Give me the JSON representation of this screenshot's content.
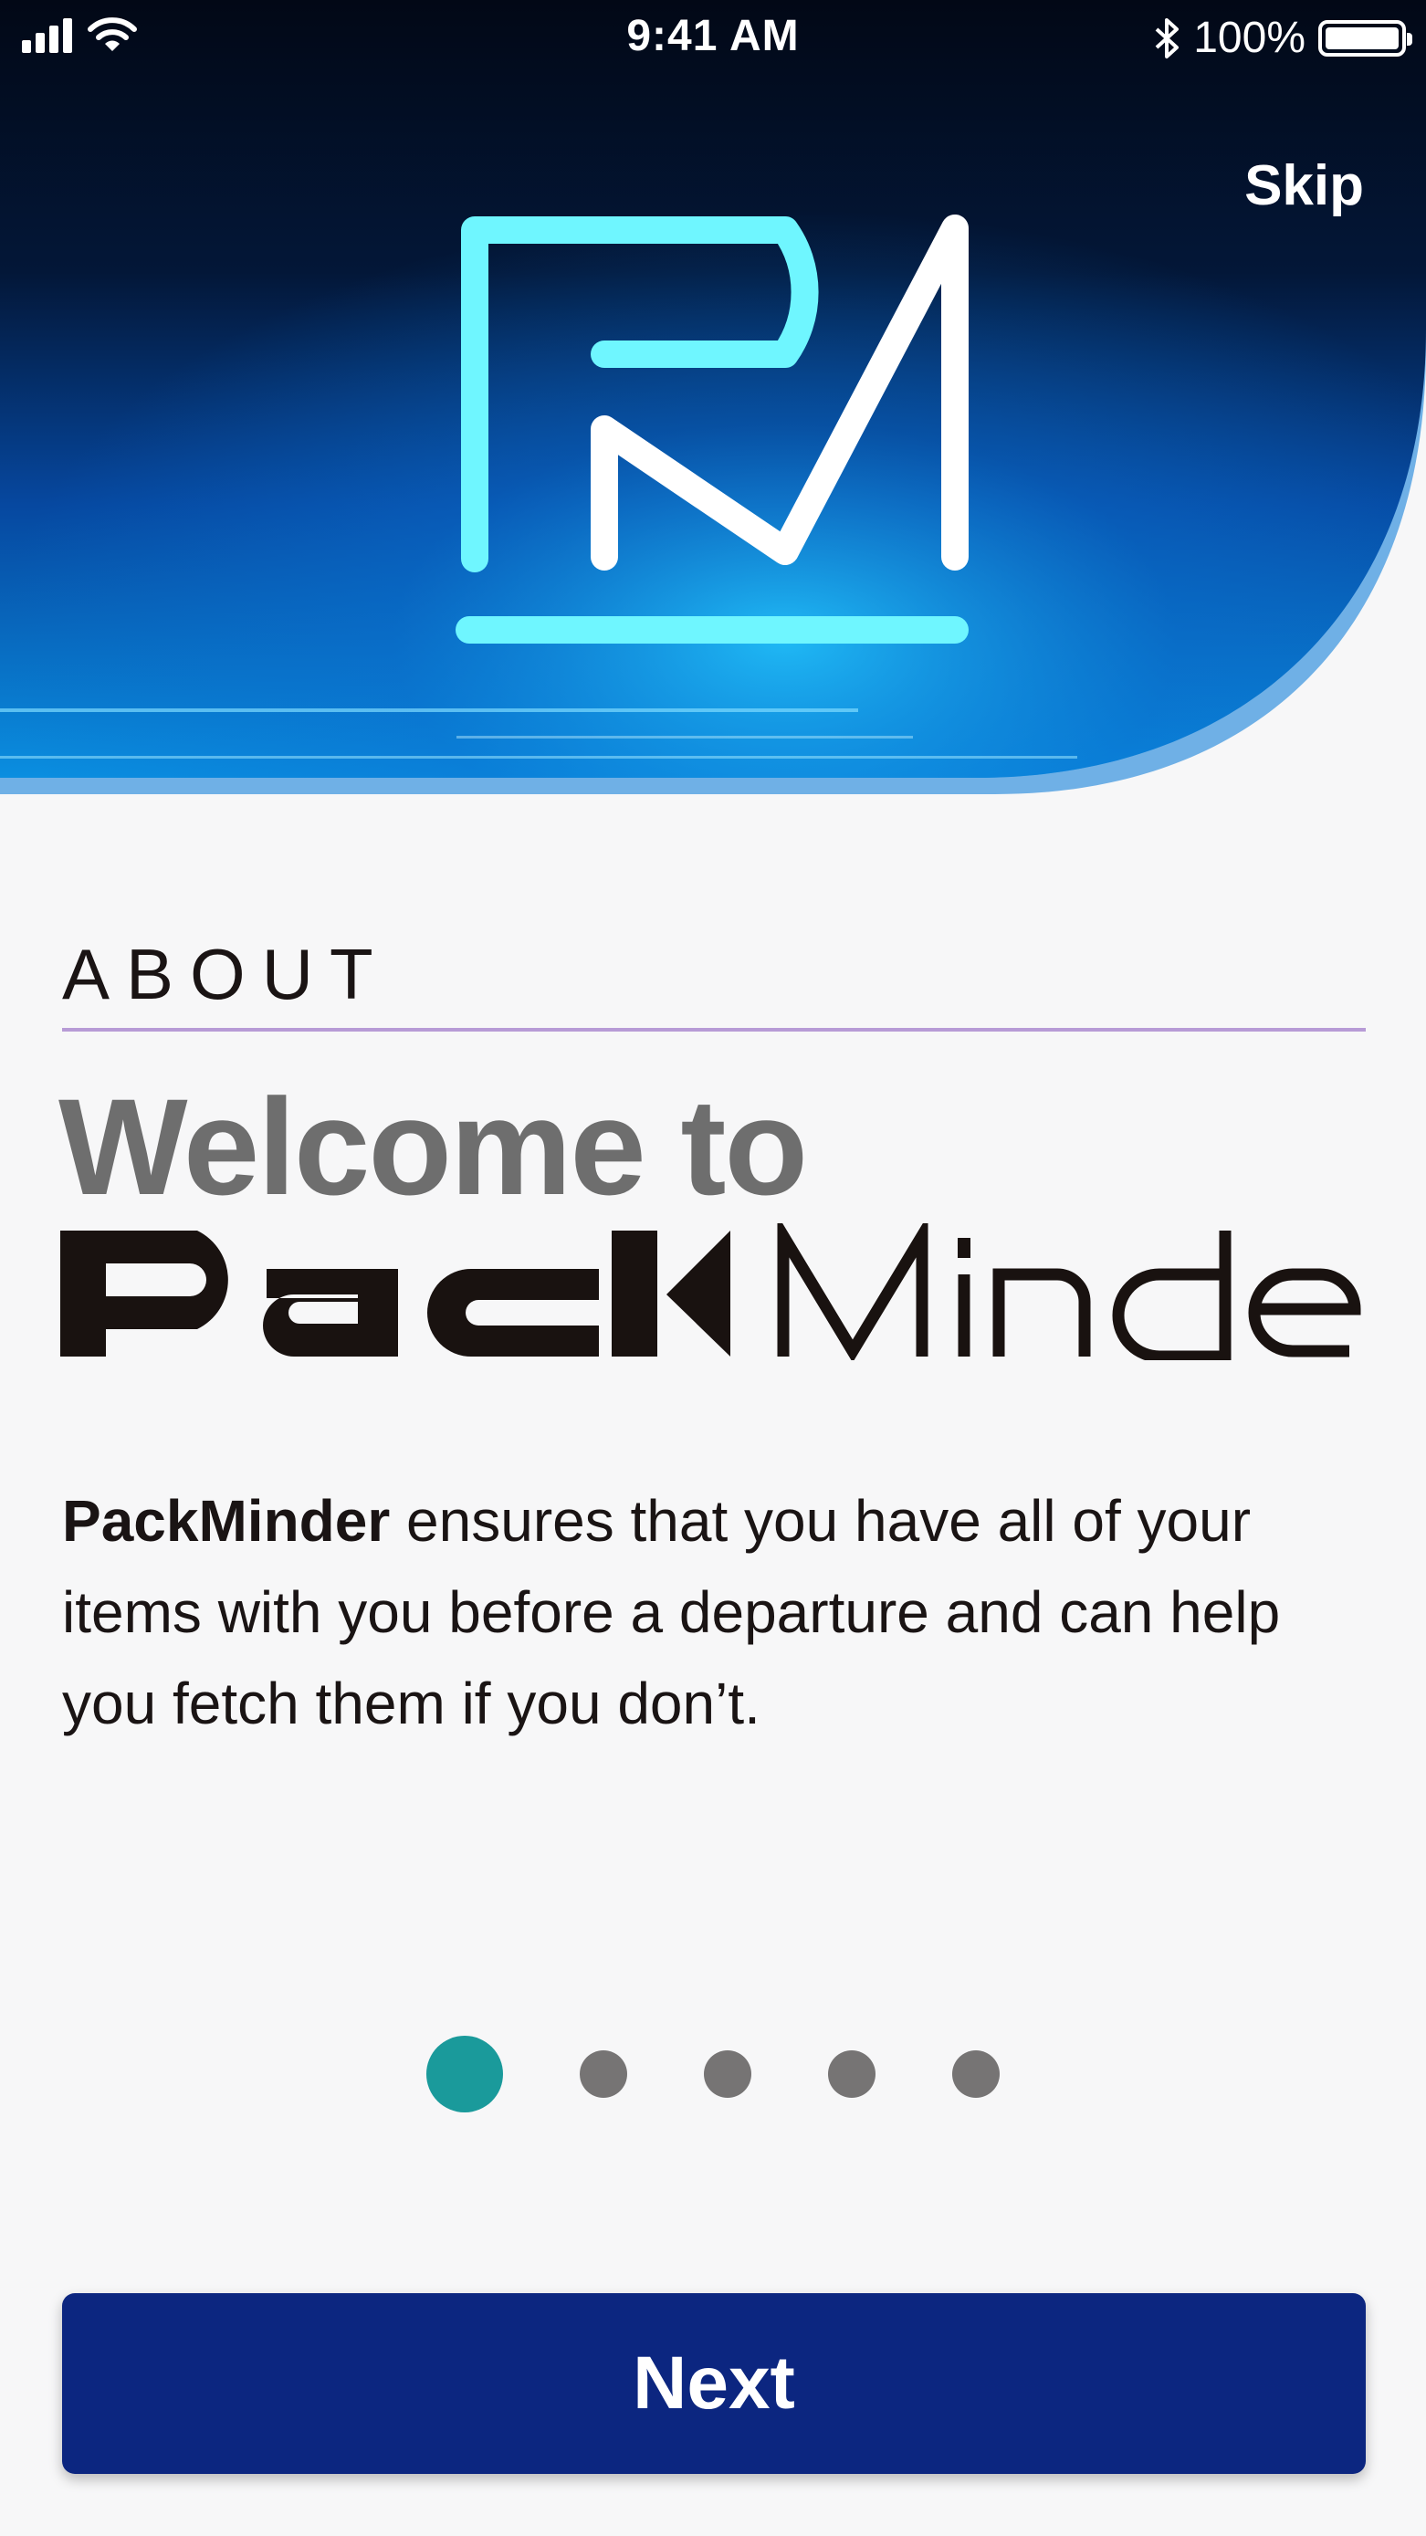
{
  "status_bar": {
    "time": "9:41 AM",
    "battery_text": "100%",
    "icons": [
      "signal-icon",
      "wifi-icon",
      "bluetooth-icon",
      "battery-icon"
    ]
  },
  "header": {
    "skip_label": "Skip",
    "logo_icon": "packminder-logo-icon"
  },
  "content": {
    "section_label": "ABOUT",
    "welcome": "Welcome to",
    "brand": "PackMinder",
    "description_strong": "PackMinder",
    "description_rest": " ensures that you have all of your items with you before a departure and can help you fetch them if you don’t."
  },
  "pager": {
    "total_pages": 5,
    "current_page": 1
  },
  "footer": {
    "next_label": "Next"
  },
  "colors": {
    "accent_teal": "#1a9a9b",
    "button_navy": "#0c2680",
    "logo_cyan": "#6ff6ff",
    "divider_lavender": "#b79bd6",
    "heading_gray": "#6e6e6e"
  }
}
